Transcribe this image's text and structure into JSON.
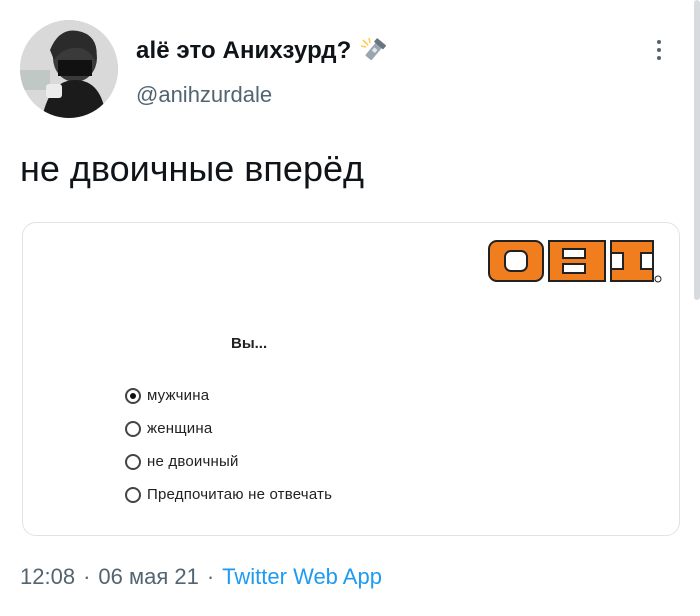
{
  "author": {
    "display_name": "alё это Анихзурд?",
    "handle": "@anihzurdale",
    "emoji_icon": "flashlight-icon"
  },
  "tweet": {
    "text": "не двоичные вперёд"
  },
  "card": {
    "logo_text": "OBI",
    "question": "Вы...",
    "options": [
      {
        "label": "мужчина",
        "checked": true
      },
      {
        "label": "женщина",
        "checked": false
      },
      {
        "label": "не двоичный",
        "checked": false
      },
      {
        "label": "Предпочитаю не отвечать",
        "checked": false
      }
    ],
    "brand_color": "#f07d1e"
  },
  "meta": {
    "time": "12:08",
    "date": "06 мая 21",
    "app": "Twitter Web App",
    "separator": "·"
  },
  "colors": {
    "link": "#1d9bf0",
    "secondary_text": "#536471"
  }
}
